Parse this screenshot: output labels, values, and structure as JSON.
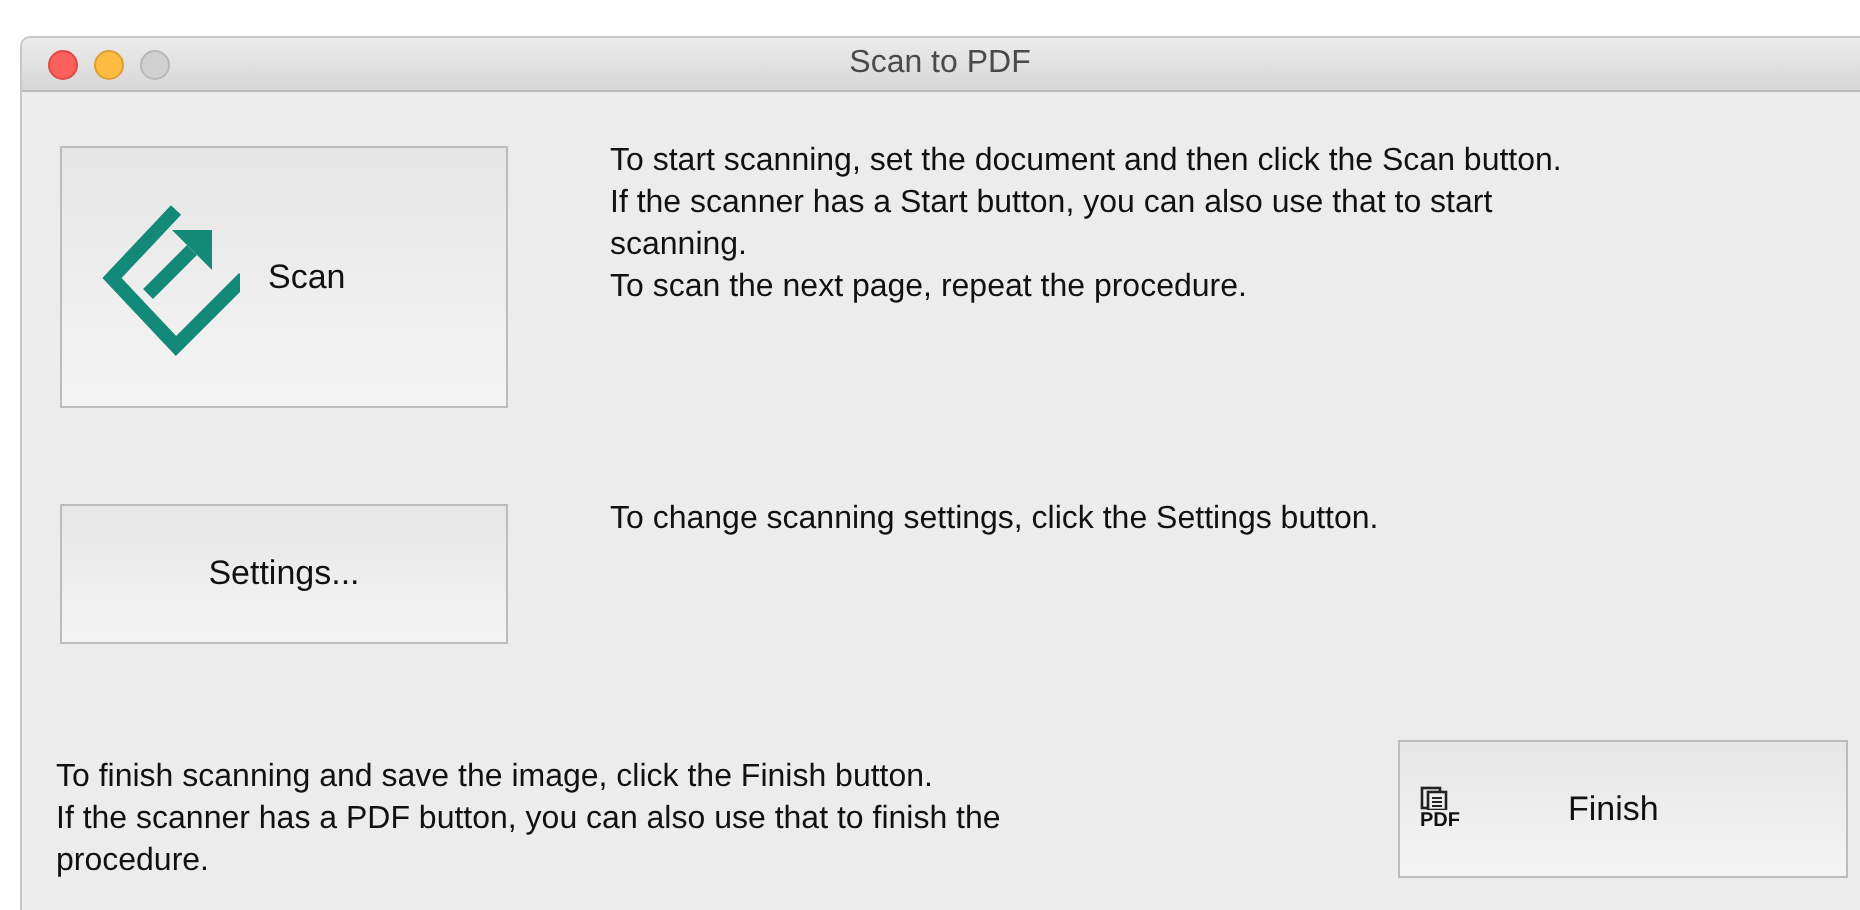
{
  "window": {
    "title": "Scan to PDF"
  },
  "scan": {
    "label": "Scan",
    "instructions": [
      "To start scanning, set the document and then click the Scan button.",
      "If the scanner has a Start button, you can also use that to start",
      "scanning.",
      "To scan the next page, repeat the procedure."
    ]
  },
  "settings": {
    "label": "Settings...",
    "instructions": [
      "To change scanning settings, click the Settings button."
    ]
  },
  "finish": {
    "label": "Finish",
    "icon_text": "PDF",
    "instructions": [
      "To finish scanning and save the image, click the Finish button.",
      "If the scanner has a PDF button, you can also use that to finish the",
      "procedure."
    ]
  }
}
